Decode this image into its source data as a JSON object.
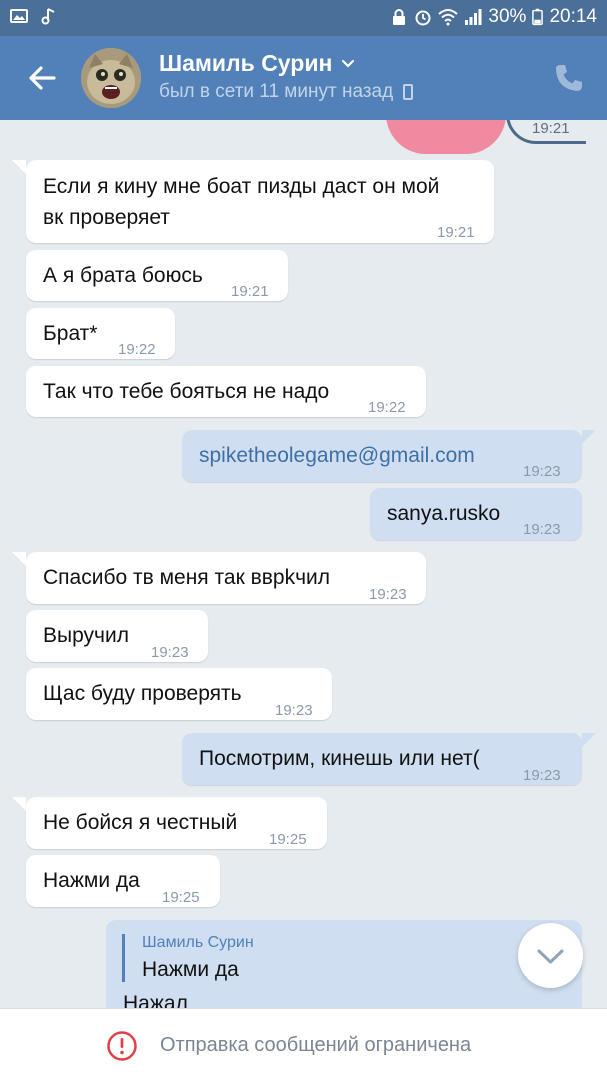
{
  "status_bar": {
    "battery": "30%",
    "time": "20:14",
    "icons": [
      "gallery-icon",
      "music-icon",
      "alarm-icon",
      "wifi-icon",
      "signal-icon",
      "battery-icon"
    ]
  },
  "header": {
    "contact_name": "Шамиль Сурин",
    "presence": "был в сети 11 минут назад",
    "back_icon": "arrow-left-icon",
    "call_icon": "phone-icon"
  },
  "chat": {
    "top_partial_time": "19:21",
    "messages": [
      {
        "dir": "in",
        "lines": [
          "Если я кину мне боат пизды даст он мой",
          "вк проверяет"
        ],
        "time": "19:21"
      },
      {
        "dir": "in",
        "text": "А я брата боюсь",
        "time": "19:21"
      },
      {
        "dir": "in",
        "text": "Брат*",
        "time": "19:22"
      },
      {
        "dir": "in",
        "text": "Так что тебе бояться не надо",
        "time": "19:22"
      },
      {
        "dir": "out",
        "text": "spiketheolegame@gmail.com",
        "time": "19:23"
      },
      {
        "dir": "out",
        "text": "sanya.rusko",
        "time": "19:23"
      },
      {
        "dir": "in",
        "text": "Спасибо тв меня так вврkчил",
        "time": "19:23"
      },
      {
        "dir": "in",
        "text": "Выручил",
        "time": "19:23"
      },
      {
        "dir": "in",
        "text": "Щас буду проверять",
        "time": "19:23"
      },
      {
        "dir": "out",
        "text": "Посмотрим, кинешь или нет(",
        "time": "19:23"
      },
      {
        "dir": "in",
        "text": "Не бойся я честный",
        "time": "19:25"
      },
      {
        "dir": "in",
        "text": "Нажми да",
        "time": "19:25"
      }
    ],
    "reply": {
      "author": "Шамиль Сурин",
      "quoted": "Нажми да",
      "answer": "Нажал"
    }
  },
  "bottom": {
    "notice": "Отправка сообщений ограничена",
    "notice_icon": "warning-circle-icon"
  },
  "colors": {
    "header": "#5181b8",
    "status_bar": "#4a6f99",
    "chat_bg": "#e6ebf0",
    "bubble_out": "#cfdff1",
    "warning": "#e0404a"
  }
}
